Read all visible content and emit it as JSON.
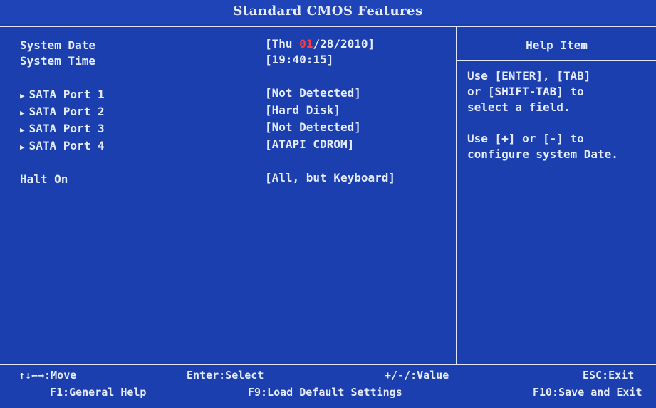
{
  "title": "Standard CMOS Features",
  "main": {
    "system_date": {
      "label": "System Date",
      "value_prefix": "[Thu ",
      "value_highlight": "01",
      "value_suffix": "/28/2010]"
    },
    "system_time": {
      "label": "System Time",
      "value": "[19:40:15]"
    },
    "sata": [
      {
        "label": "SATA Port 1",
        "value": "[Not Detected]"
      },
      {
        "label": "SATA Port 2",
        "value": "[Hard Disk]"
      },
      {
        "label": "SATA Port 3",
        "value": "[Not Detected]"
      },
      {
        "label": "SATA Port 4",
        "value": "[ATAPI CDROM]"
      }
    ],
    "halt_on": {
      "label": "Halt On",
      "value": "[All, but Keyboard]"
    }
  },
  "help": {
    "title": "Help Item",
    "text": "Use [ENTER], [TAB]\nor [SHIFT-TAB] to\nselect a field.\n\nUse [+] or [-] to\nconfigure system Date."
  },
  "footer": {
    "move": "↑↓←→:Move",
    "select": "Enter:Select",
    "value": "+/-/:Value",
    "exit": "ESC:Exit",
    "general_help": "F1:General Help",
    "defaults": "F9:Load Default Settings",
    "save_exit": "F10:Save and Exit"
  },
  "icons": {
    "submenu_arrow": "triangle-right-icon"
  },
  "colors": {
    "background": "#1b3fae",
    "text": "#e6ecff",
    "highlight": "#ff3b3b"
  }
}
